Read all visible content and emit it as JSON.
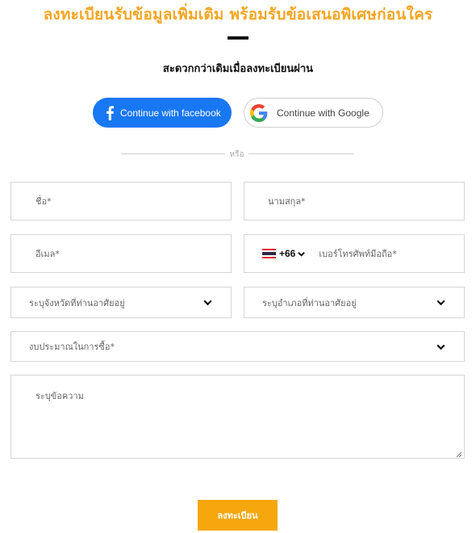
{
  "header": {
    "title": "ลงทะเบียนรับข้อมูลเพิ่มเติม พร้อมรับข้อเสนอพิเศษก่อนใคร",
    "subtitle": "สะดวกกว่าเดิมเมื่อลงทะเบียนผ่าน"
  },
  "social": {
    "facebook_label": "Continue with facebook",
    "google_label": "Continue with Google",
    "divider_text": "หรือ"
  },
  "form": {
    "first_name_placeholder": "ชื่อ*",
    "last_name_placeholder": "นามสกุล*",
    "email_placeholder": "อีเมล*",
    "phone_country_code": "+66",
    "phone_placeholder": "เบอร์โทรศัพท์มือถือ*",
    "province_placeholder": "ระบุจังหวัดที่ท่านอาศัยอยู่",
    "district_placeholder": "ระบุอำเภอที่ท่านอาศัยอยู่",
    "budget_placeholder": "งบประมาณในการซื้อ*",
    "message_placeholder": "ระบุข้อความ",
    "submit_label": "ลงทะเบียน"
  },
  "colors": {
    "accent": "#f5a623",
    "facebook": "#1877f2",
    "submit": "#f5a70d"
  },
  "icons": [
    "facebook-icon",
    "google-icon",
    "thailand-flag-icon",
    "chevron-down-icon",
    "resize-handle-icon"
  ]
}
